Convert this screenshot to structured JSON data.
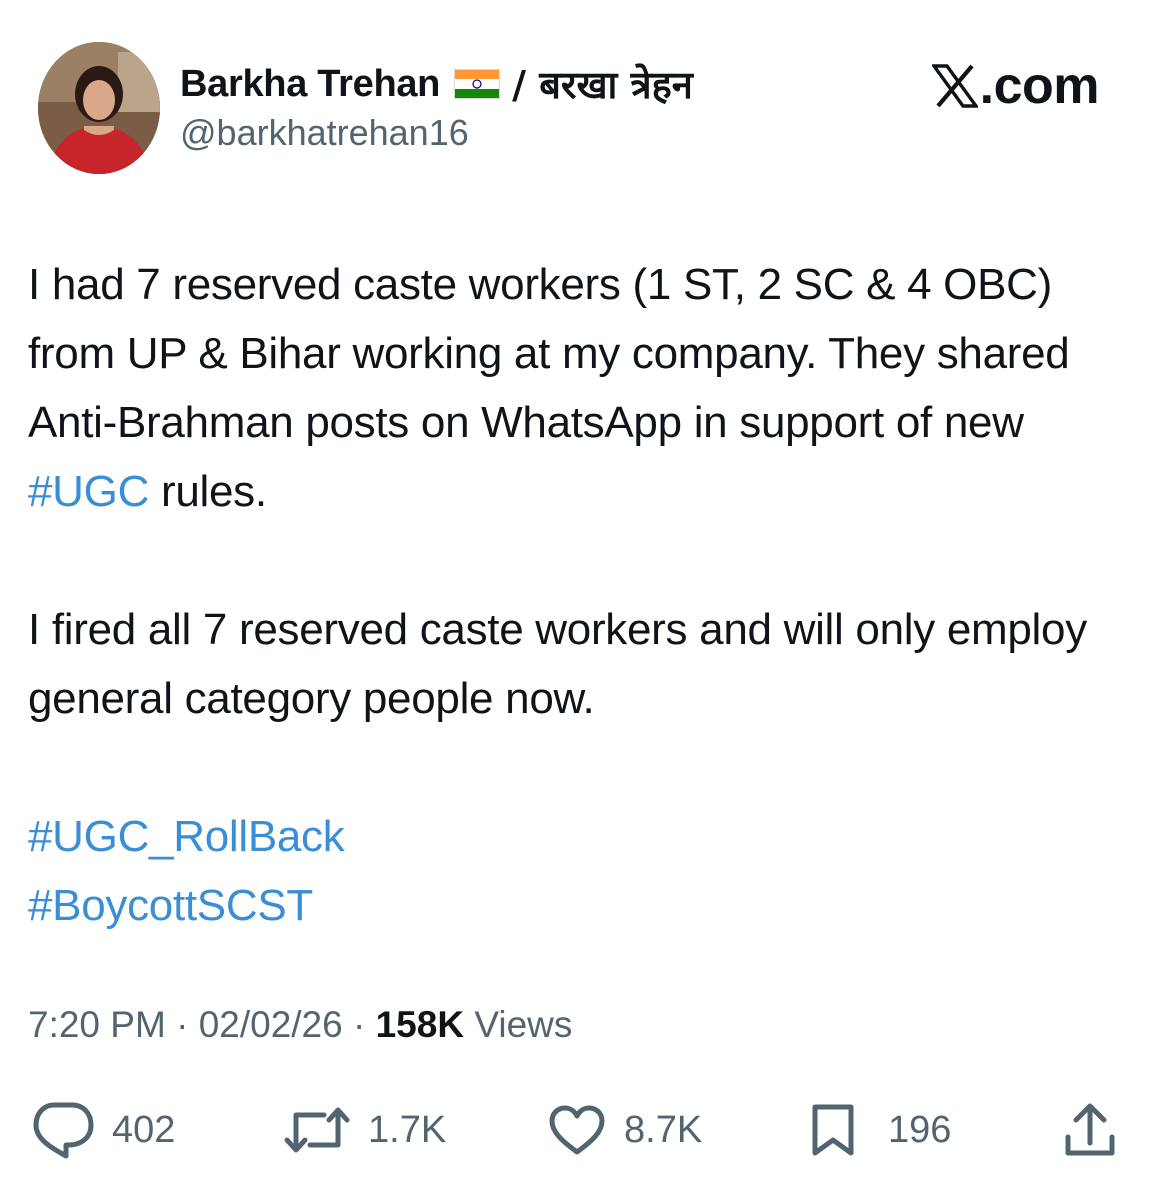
{
  "brand": {
    "label": ".com"
  },
  "author": {
    "display_name": "Barkha Trehan",
    "name_suffix": "/ बरखा त्रेहन",
    "handle": "@barkhatrehan16"
  },
  "post": {
    "paragraph1_before": "I had 7 reserved caste workers (1 ST, 2 SC & 4 OBC) from UP & Bihar working at my company. They shared Anti-Brahman posts on WhatsApp in support of new ",
    "paragraph1_hashtag": "#UGC",
    "paragraph1_after": " rules.",
    "paragraph2": "I fired all 7 reserved caste workers and will only employ general category people now.",
    "hashtags": [
      "#UGC_RollBack",
      "#BoycottSCST"
    ]
  },
  "meta": {
    "time": "7:20 PM",
    "separator": "·",
    "date": "02/02/26",
    "views_count": "158K",
    "views_label": "Views"
  },
  "actions": {
    "replies": "402",
    "reposts": "1.7K",
    "likes": "8.7K",
    "bookmarks": "196"
  },
  "icons": {
    "reply": "reply-icon",
    "repost": "repost-icon",
    "like": "heart-icon",
    "bookmark": "bookmark-icon",
    "share": "share-icon",
    "x_logo": "x-logo-icon"
  },
  "colors": {
    "hashtag": "#3a8ed6",
    "secondary_text": "#536471",
    "primary_text": "#0f1419"
  }
}
